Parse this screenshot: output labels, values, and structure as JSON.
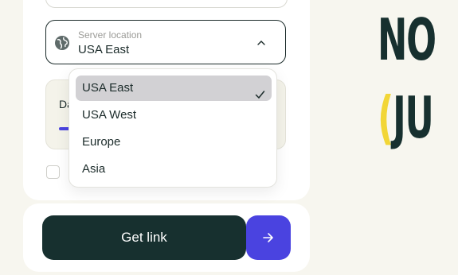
{
  "form": {
    "location_field": {
      "label": "Server location",
      "value": "USA East",
      "icon": "globe-icon",
      "chevron": "chevron-up-icon"
    },
    "dropdown": {
      "options": [
        {
          "label": "USA East",
          "selected": true
        },
        {
          "label": "USA West",
          "selected": false
        },
        {
          "label": "Europe",
          "selected": false
        },
        {
          "label": "Asia",
          "selected": false
        }
      ],
      "selected_icon": "check-icon"
    },
    "hidden_panel": {
      "text_fragment": "Da"
    },
    "checkbox": {
      "checked": false
    }
  },
  "actions": {
    "get_link_label": "Get link",
    "arrow_icon": "arrow-right-icon"
  },
  "hero": {
    "line1": "NO",
    "line2_bracket": "(",
    "line2_text": "JU"
  },
  "colors": {
    "background": "#f7f6ef",
    "dark": "#17302f",
    "accent": "#4a43e0",
    "highlight": "#f2d637",
    "selected_option": "#d2d1d4"
  }
}
